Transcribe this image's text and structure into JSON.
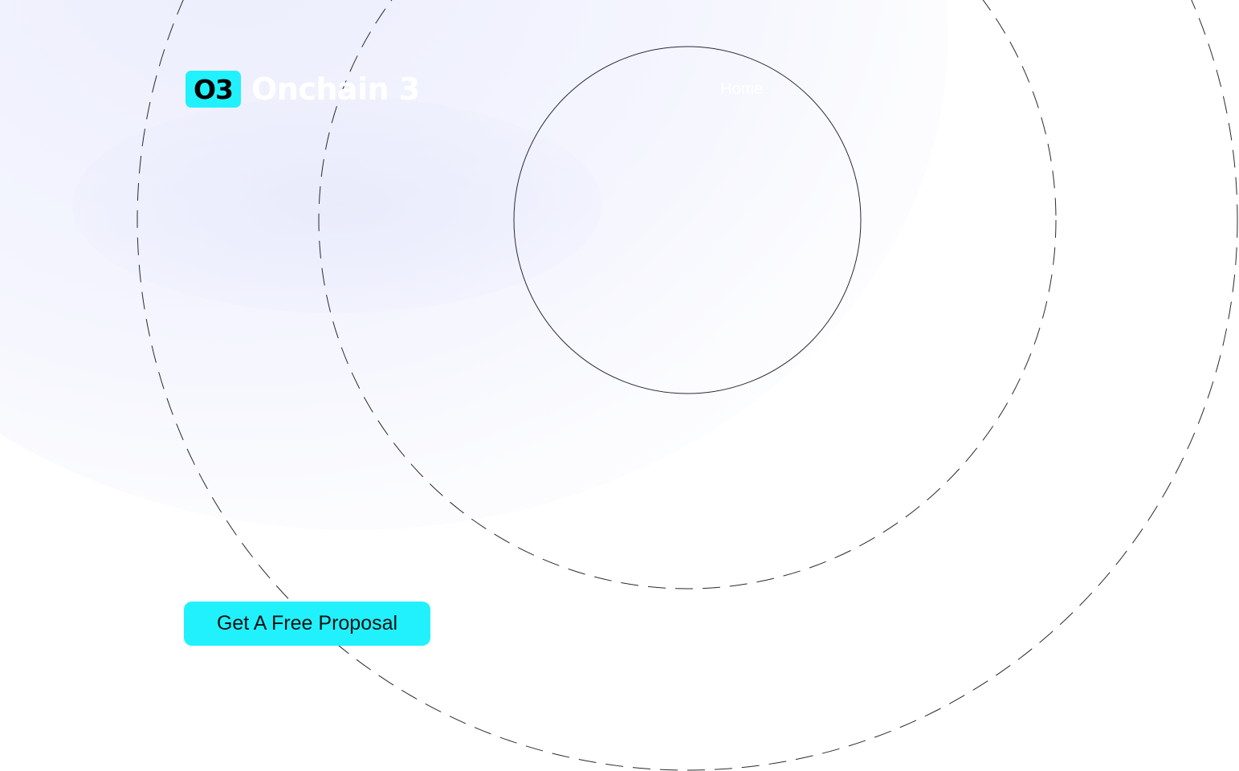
{
  "brand": {
    "badge_text": "O3",
    "name": "Onchain 3"
  },
  "nav": {
    "home_label": "Home"
  },
  "hero": {
    "cta_label": "Get A Free Proposal"
  },
  "colors": {
    "accent": "#21f1fd",
    "background": "#ffffff",
    "ring_stroke": "#2a2a2a"
  }
}
